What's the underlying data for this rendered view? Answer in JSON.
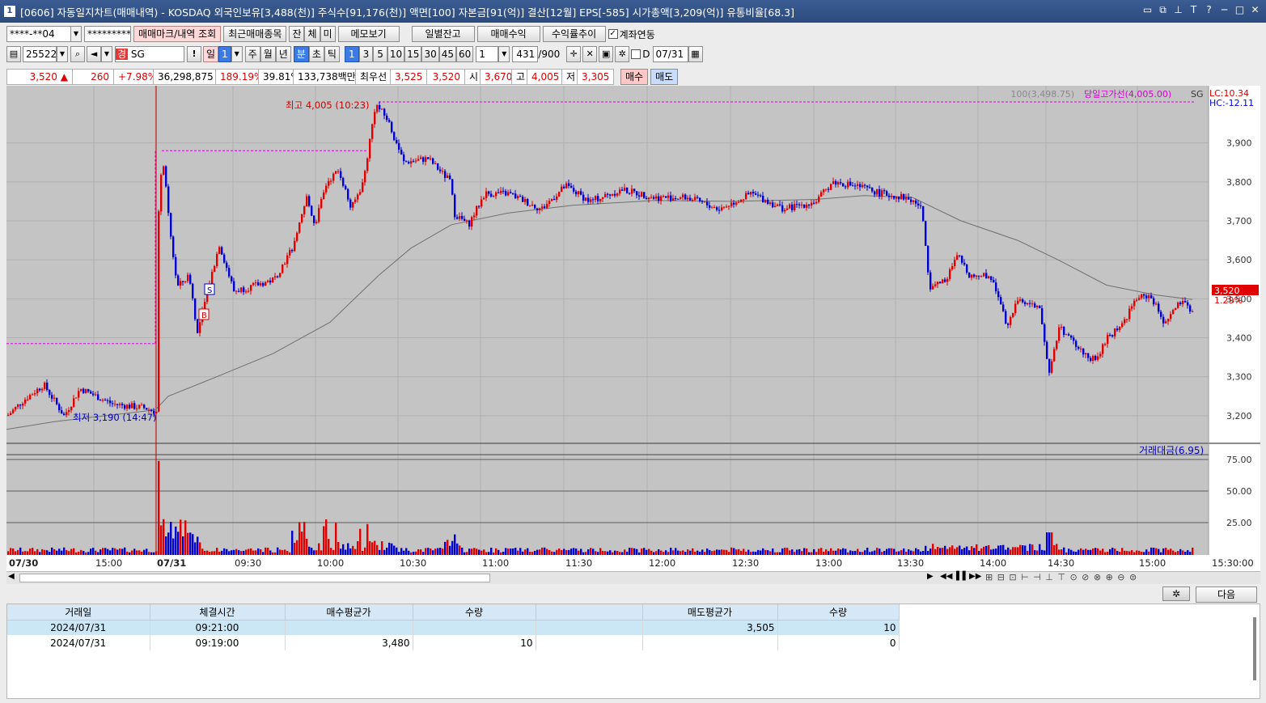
{
  "window": {
    "number": "1",
    "title": "[0606] 자동일지차트(매매내역) - KOSDAQ 외국인보유[3,488(천)] 주식수[91,176(천)] 액면[100] 자본금[91(억)] 결산[12월] EPS[-585] 시가총액[3,209(억)] 유통비율[68.3]"
  },
  "toolbar1": {
    "account": "****-**04",
    "password": "*********",
    "btn_trade_mark": "매매마크/내역 조회",
    "btn_recent": "최근매매종목",
    "tab_jan": "잔",
    "tab_che": "체",
    "tab_mi": "미",
    "btn_memo": "메모보기",
    "btn_daily": "일별잔고",
    "btn_trade_profit": "매매수익",
    "btn_return": "수익률추이",
    "chk_account_link": "계좌연동"
  },
  "toolbar2": {
    "code": "255220",
    "name_prefix": "경",
    "name": "SG",
    "period_day": "일",
    "period_day_num": "1",
    "period_week": "주",
    "period_month": "월",
    "period_year": "년",
    "period_min": "분",
    "period_sec": "초",
    "period_tick": "틱",
    "intervals": [
      "1",
      "3",
      "5",
      "10",
      "15",
      "30",
      "45",
      "60"
    ],
    "interval_custom": "1",
    "count": "431",
    "count_max": "/900",
    "chk_d": "D",
    "date": "07/31"
  },
  "quote": {
    "price": "3,520",
    "arrow": "▲",
    "change": "260",
    "change_pct": "+7.98%",
    "volume": "36,298,875",
    "vol_ratio": "189.19%",
    "turnover": "39.81%",
    "amount": "133,738백만",
    "best_ask_label": "최우선",
    "best_ask": "3,525",
    "best_bid": "3,520",
    "open_label": "시",
    "open": "3,670",
    "high_label": "고",
    "high": "4,005",
    "low_label": "저",
    "low": "3,305",
    "buy_btn": "매수",
    "sell_btn": "매도"
  },
  "colors": {
    "up": "#e00000",
    "down": "#0000d0",
    "ma": "#707070",
    "guide": "#e000e0",
    "bg": "#c4c4c4"
  },
  "chart": {
    "legend_ma": "100(3,498.75)",
    "legend_highline": "당일고가선(4,005.00)",
    "legend_name": "SG",
    "lc": "LC:10.34",
    "hc": "HC:-12.11",
    "high_note": "최고 4,005 (10:23)",
    "low_note": "최저 3,190 (14:47)",
    "marker_s": "S",
    "marker_b": "B",
    "price_ticks": [
      "3,900",
      "3,800",
      "3,700",
      "3,600",
      "3,500",
      "3,400",
      "3,300",
      "3,200"
    ],
    "current_price": "3,520",
    "current_pct": "1.29%",
    "vol_legend": "거래대금(6.95)",
    "vol_ticks": [
      "75.00",
      "50.00",
      "25.00"
    ],
    "time_labels": [
      "07/30",
      "15:00",
      "07/31",
      "09:30",
      "10:00",
      "10:30",
      "11:00",
      "11:30",
      "12:00",
      "12:30",
      "13:00",
      "13:30",
      "14:00",
      "14:30",
      "15:00",
      "15:30:00"
    ]
  },
  "chart_data": {
    "type": "candlestick",
    "ylim": [
      3150,
      4030
    ],
    "key_points": [
      {
        "t": "07/30 14:47",
        "price": 3190
      },
      {
        "t": "07/31 10:23",
        "price": 4005
      },
      {
        "t": "07/31 09:05",
        "price": 3880
      },
      {
        "t": "07/31 09:19",
        "price": 3480
      },
      {
        "t": "07/31 09:21",
        "price": 3505
      },
      {
        "t": "07/31 11:00",
        "price": 3690
      },
      {
        "t": "07/31 13:30",
        "price": 3730
      },
      {
        "t": "07/31 13:35",
        "price": 3530
      },
      {
        "t": "07/31 14:00",
        "price": 3420
      },
      {
        "t": "07/31 14:20",
        "price": 3310
      },
      {
        "t": "07/31 15:00",
        "price": 3510
      },
      {
        "t": "07/31 15:20",
        "price": 3520
      }
    ],
    "prev_day_close_line": 3385,
    "today_high_line": 4005,
    "volume_ylim": [
      0,
      100
    ]
  },
  "scroll": {
    "nav": [
      "◀◀",
      "▌▌",
      "▶▶"
    ],
    "icons": "⊞ ⊟ ⊡ ⊢ ⊣ ⊥ ⊤ ⊙ ⊘ ⊗ ⊕ ⊖ ⊜"
  },
  "table": {
    "headers": [
      "거래일",
      "체결시간",
      "매수평균가",
      "수량",
      "",
      "매도평균가",
      "수량"
    ],
    "rows": [
      [
        "2024/07/31",
        "09:21:00",
        "",
        "",
        "",
        "3,505",
        "10"
      ],
      [
        "2024/07/31",
        "09:19:00",
        "3,480",
        "10",
        "",
        "",
        "0"
      ]
    ],
    "next_btn": "다음"
  }
}
